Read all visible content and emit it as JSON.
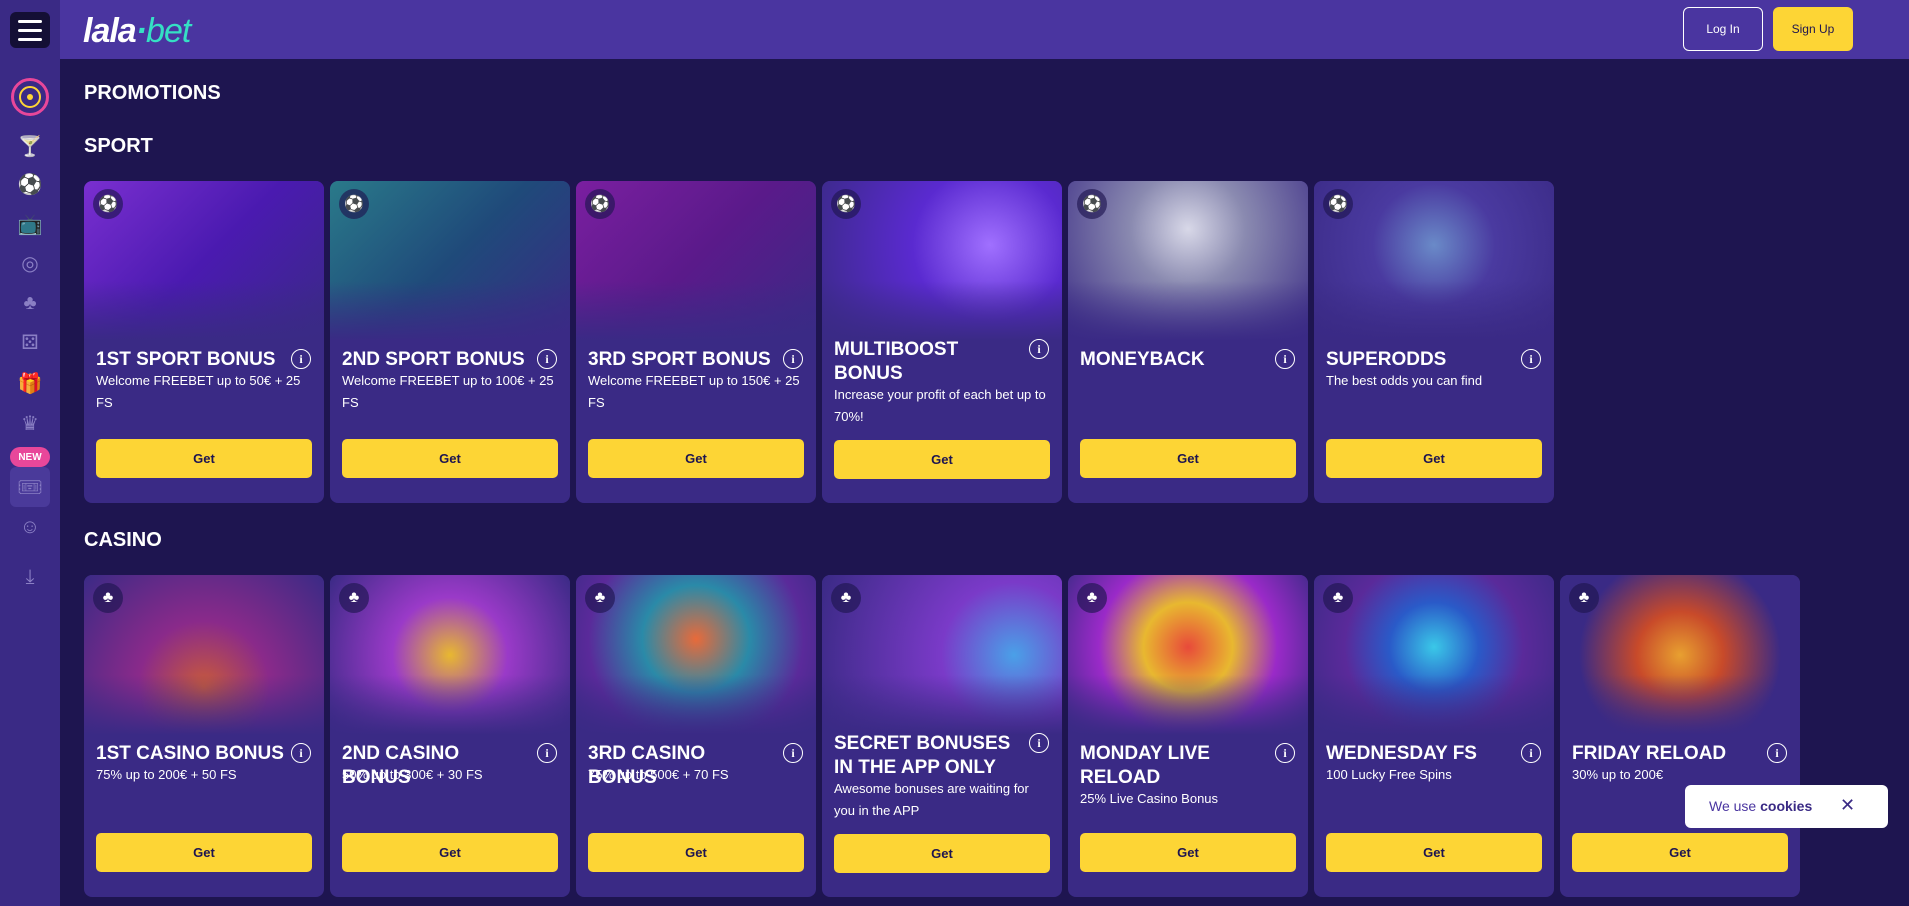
{
  "header": {
    "logo_part1": "lala",
    "logo_dot": "·",
    "logo_part2": "bet",
    "login_label": "Log In",
    "signup_label": "Sign Up"
  },
  "sidebar": {
    "new_badge": "NEW",
    "icons": [
      "cocktail-icon",
      "soccer-ball-icon",
      "live-tv-icon",
      "roulette-icon",
      "casino-chips-icon",
      "dice-icon",
      "gift-icon",
      "crown-icon",
      "ticket-icon",
      "support-agent-icon",
      "download-icon"
    ]
  },
  "page": {
    "title": "PROMOTIONS"
  },
  "sport": {
    "title": "SPORT",
    "cards": [
      {
        "title": "1ST SPORT BONUS",
        "desc": "Welcome FREEBET up to 50€ + 25 FS",
        "button": "Get",
        "icon": "⚽"
      },
      {
        "title": "2ND SPORT BONUS",
        "desc": "Welcome FREEBET up to 100€ + 25 FS",
        "button": "Get",
        "icon": "⚽"
      },
      {
        "title": "3RD SPORT BONUS",
        "desc": "Welcome FREEBET up to 150€ + 25 FS",
        "button": "Get",
        "icon": "⚽"
      },
      {
        "title": "MULTIBOOST BONUS",
        "desc": "Increase your profit of each bet up to 70%!",
        "button": "Get",
        "icon": "⚽"
      },
      {
        "title": "MONEYBACK",
        "desc": "",
        "button": "Get",
        "icon": "⚽"
      },
      {
        "title": "SUPERODDS",
        "desc": "The best odds you can find",
        "button": "Get",
        "icon": "⚽"
      }
    ]
  },
  "casino": {
    "title": "CASINO",
    "cards": [
      {
        "title": "1ST CASINO BONUS",
        "desc": "75% up to 200€ + 50 FS",
        "button": "Get",
        "icon": "♣"
      },
      {
        "title": "2ND CASINO BONUS",
        "desc": "50% up to 300€ + 30 FS",
        "button": "Get",
        "icon": "♣"
      },
      {
        "title": "3RD CASINO BONUS",
        "desc": "75% up to 500€ + 70 FS",
        "button": "Get",
        "icon": "♣"
      },
      {
        "title": "SECRET BONUSES IN THE APP ONLY",
        "desc": "Awesome bonuses are waiting for you in the APP",
        "button": "Get",
        "icon": "♣"
      },
      {
        "title": "MONDAY LIVE RELOAD",
        "desc": "25% Live Casino Bonus",
        "button": "Get",
        "icon": "♣"
      },
      {
        "title": "WEDNESDAY FS",
        "desc": "100 Lucky Free Spins",
        "button": "Get",
        "icon": "♣"
      },
      {
        "title": "FRIDAY RELOAD",
        "desc": "30% up to 200€",
        "button": "Get",
        "icon": "♣"
      }
    ]
  },
  "cookie": {
    "text": "We use",
    "link": "cookies",
    "close": "✕"
  }
}
